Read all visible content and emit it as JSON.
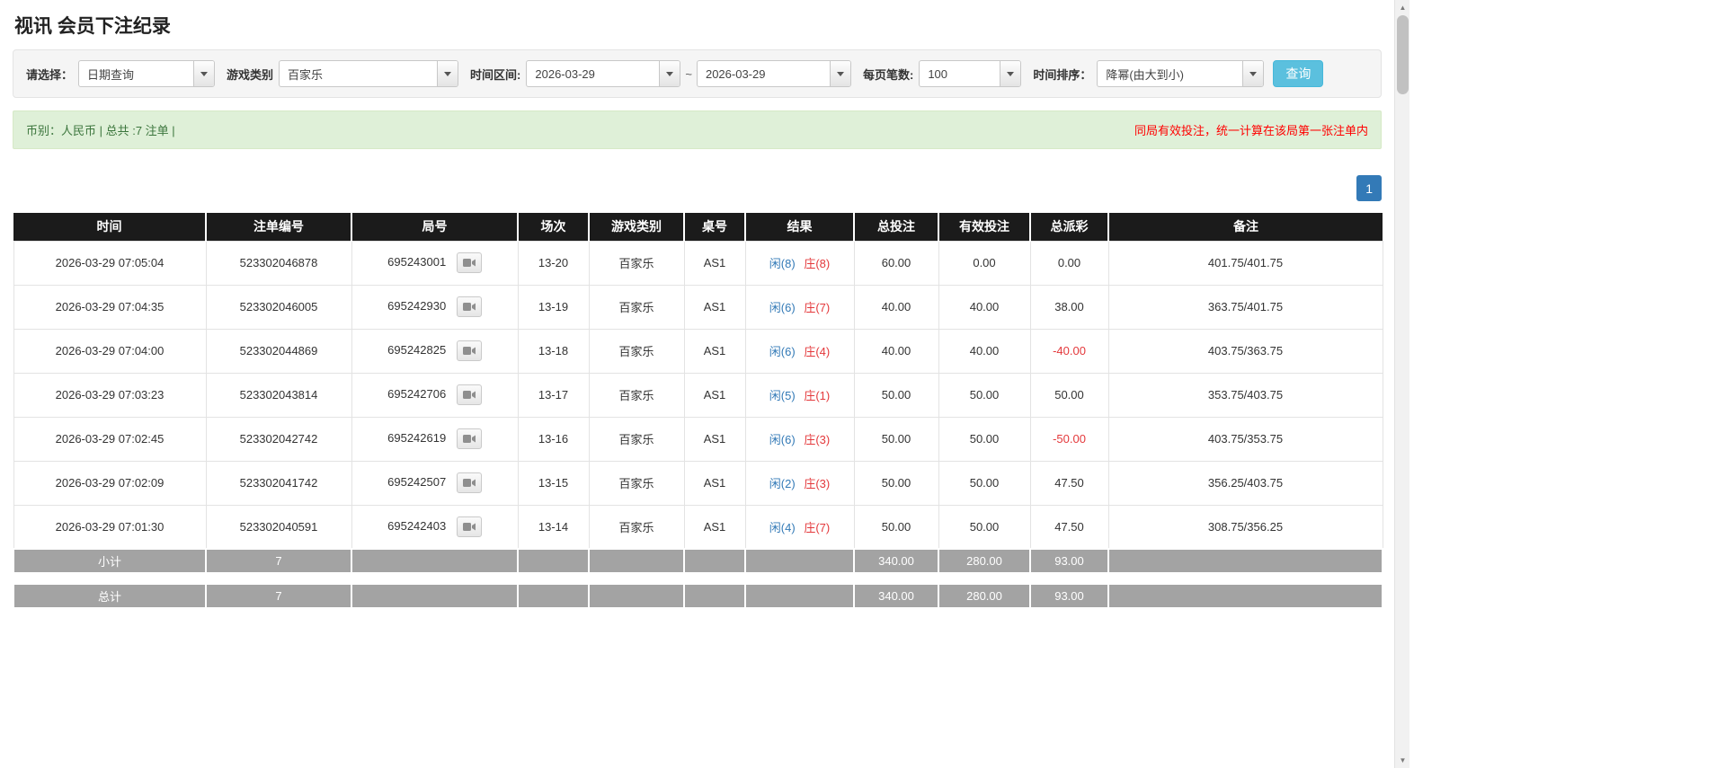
{
  "page": {
    "title": "视讯 会员下注纪录"
  },
  "colors": {
    "table_header_bg": "#1b1b1b",
    "table_footer_bg": "#a3a3a3",
    "link_blue": "#337ab7",
    "player_blue": "#337ab7",
    "banker_red": "#e4393c",
    "negative_red": "#e4393c",
    "notice_red": "#ff0000",
    "alert_bg": "#dff0d8",
    "alert_text": "#3c763d",
    "search_button_bg": "#5bc0de",
    "pagination_active_bg": "#337ab7"
  },
  "icons": {
    "dropdown_caret": "chevron-down-icon",
    "round_detail": "video-replay-icon",
    "scroll_up_glyph": "▲",
    "scroll_down_glyph": "▼"
  },
  "filters": {
    "select_label": "请选择：",
    "select_value": "日期查询",
    "game_type_label": "游戏类别",
    "game_type_value": "百家乐",
    "time_range_label": "时间区间:",
    "date_from": "2026-03-29",
    "range_separator": "~",
    "date_to": "2026-03-29",
    "page_size_label": "每页笔数:",
    "page_size_value": "100",
    "sort_label": "时间排序：",
    "sort_value": "降幂(由大到小)",
    "search_button_label": "查询"
  },
  "summary": {
    "currency_info": "币别：人民币 | 总共 :7 注单 |",
    "notice": "同局有效投注，统一计算在该局第一张注单内"
  },
  "pagination": {
    "current_page": "1"
  },
  "table": {
    "headers": [
      "时间",
      "注单编号",
      "局号",
      "场次",
      "游戏类别",
      "桌号",
      "结果",
      "总投注",
      "有效投注",
      "总派彩",
      "备注"
    ],
    "rows": [
      {
        "time": "2026-03-29 07:05:04",
        "bet_id": "523302046878",
        "round": "695243001",
        "session": "13-20",
        "game": "百家乐",
        "table_no": "AS1",
        "result_player": "闲(8)",
        "result_banker": "庄(8)",
        "total_bet": "60.00",
        "valid_bet": "0.00",
        "payout": "0.00",
        "note": "401.75/401.75"
      },
      {
        "time": "2026-03-29 07:04:35",
        "bet_id": "523302046005",
        "round": "695242930",
        "session": "13-19",
        "game": "百家乐",
        "table_no": "AS1",
        "result_player": "闲(6)",
        "result_banker": "庄(7)",
        "total_bet": "40.00",
        "valid_bet": "40.00",
        "payout": "38.00",
        "note": "363.75/401.75"
      },
      {
        "time": "2026-03-29 07:04:00",
        "bet_id": "523302044869",
        "round": "695242825",
        "session": "13-18",
        "game": "百家乐",
        "table_no": "AS1",
        "result_player": "闲(6)",
        "result_banker": "庄(4)",
        "total_bet": "40.00",
        "valid_bet": "40.00",
        "payout": "-40.00",
        "note": "403.75/363.75"
      },
      {
        "time": "2026-03-29 07:03:23",
        "bet_id": "523302043814",
        "round": "695242706",
        "session": "13-17",
        "game": "百家乐",
        "table_no": "AS1",
        "result_player": "闲(5)",
        "result_banker": "庄(1)",
        "total_bet": "50.00",
        "valid_bet": "50.00",
        "payout": "50.00",
        "note": "353.75/403.75"
      },
      {
        "time": "2026-03-29 07:02:45",
        "bet_id": "523302042742",
        "round": "695242619",
        "session": "13-16",
        "game": "百家乐",
        "table_no": "AS1",
        "result_player": "闲(6)",
        "result_banker": "庄(3)",
        "total_bet": "50.00",
        "valid_bet": "50.00",
        "payout": "-50.00",
        "note": "403.75/353.75"
      },
      {
        "time": "2026-03-29 07:02:09",
        "bet_id": "523302041742",
        "round": "695242507",
        "session": "13-15",
        "game": "百家乐",
        "table_no": "AS1",
        "result_player": "闲(2)",
        "result_banker": "庄(3)",
        "total_bet": "50.00",
        "valid_bet": "50.00",
        "payout": "47.50",
        "note": "356.25/403.75"
      },
      {
        "time": "2026-03-29 07:01:30",
        "bet_id": "523302040591",
        "round": "695242403",
        "session": "13-14",
        "game": "百家乐",
        "table_no": "AS1",
        "result_player": "闲(4)",
        "result_banker": "庄(7)",
        "total_bet": "50.00",
        "valid_bet": "50.00",
        "payout": "47.50",
        "note": "308.75/356.25"
      }
    ],
    "subtotal": {
      "label": "小计",
      "count": "7",
      "total_bet": "340.00",
      "valid_bet": "280.00",
      "payout": "93.00"
    },
    "total": {
      "label": "总计",
      "count": "7",
      "total_bet": "340.00",
      "valid_bet": "280.00",
      "payout": "93.00"
    }
  }
}
